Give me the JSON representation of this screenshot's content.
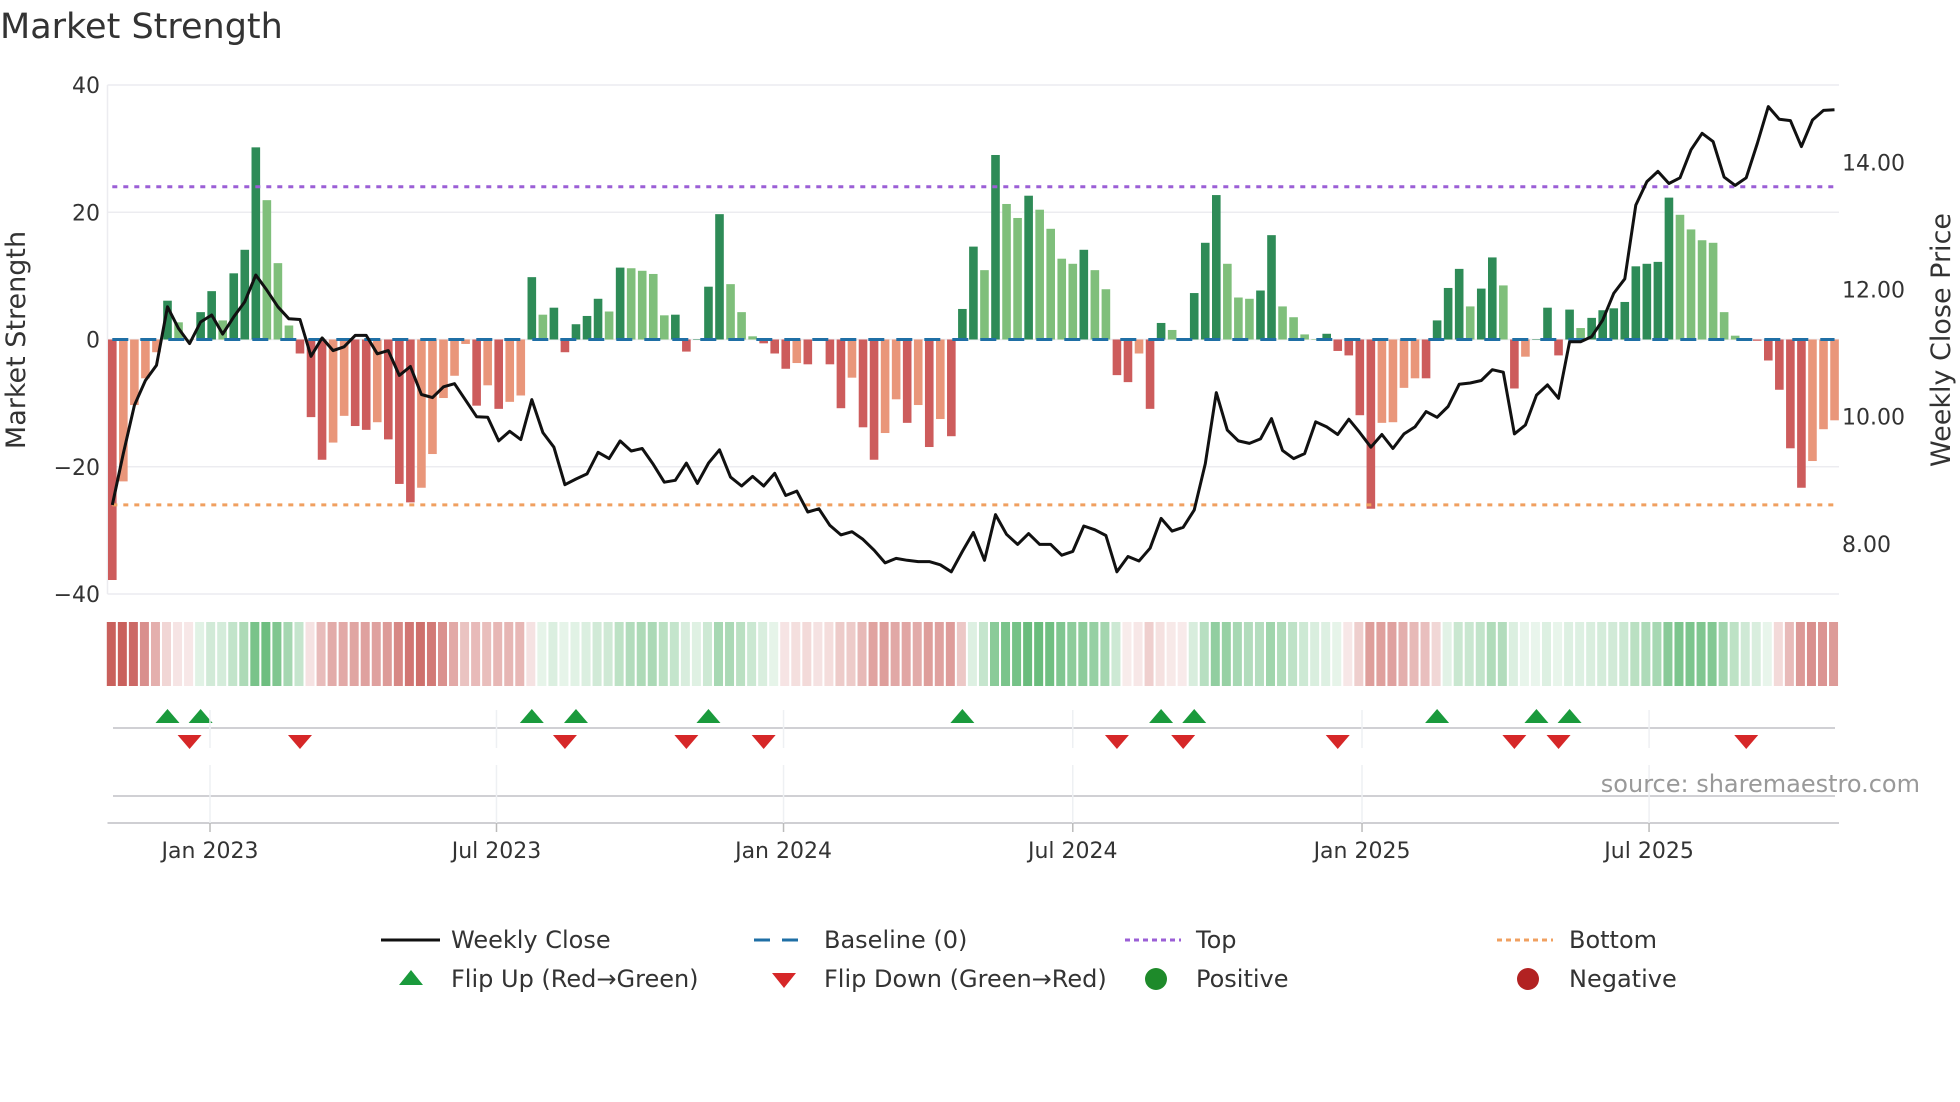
{
  "chart_data": {
    "type": "bar",
    "title": "Market Strength",
    "ylabel": "Market Strength",
    "y2label": "Weekly Close Price",
    "ylim": [
      -40,
      40
    ],
    "y2lim": [
      7.21,
      15.22
    ],
    "yticks": [
      "40",
      "20",
      "0",
      "−20",
      "−40"
    ],
    "ytick_values": [
      40,
      20,
      0,
      -20,
      -40
    ],
    "y2ticks": [
      "8.00",
      "10.00",
      "12.00",
      "14.00"
    ],
    "y2tick_values": [
      8,
      10,
      12,
      14
    ],
    "x_ticks": [
      {
        "label": "Jan 2023",
        "week": 8.85
      },
      {
        "label": "Jul 2023",
        "week": 34.8
      },
      {
        "label": "Jan 2024",
        "week": 60.8
      },
      {
        "label": "Jul 2024",
        "week": 87.0
      },
      {
        "label": "Jan 2025",
        "week": 113.2
      },
      {
        "label": "Jul 2025",
        "week": 139.2
      }
    ],
    "top_level": 24,
    "bottom_level": -26,
    "baseline": 0,
    "grid": true,
    "legend_placement": "bottom",
    "strength": [
      -37.8,
      -22.3,
      -10.3,
      -6.1,
      -2,
      6.1,
      2.7,
      0,
      4.3,
      7.6,
      3.0,
      10.4,
      14.1,
      30.2,
      21.9,
      12.0,
      2.2,
      -2.2,
      -12.2,
      -18.9,
      -16.2,
      -12,
      -13.6,
      -14.2,
      -13,
      -15.7,
      -22.7,
      -25.6,
      -23.3,
      -18,
      -9.2,
      -5.7,
      -0.7,
      -10.4,
      -7.2,
      -10.9,
      -9.8,
      -8.8,
      9.8,
      3.9,
      5,
      -2.0,
      2.4,
      3.7,
      6.4,
      4.4,
      11.3,
      11.2,
      10.8,
      10.3,
      3.8,
      3.9,
      -1.9,
      0,
      8.3,
      19.7,
      8.7,
      4.3,
      0.5,
      -0.6,
      -2.2,
      -4.6,
      -3.7,
      -3.9,
      0,
      -3.9,
      -10.8,
      -6,
      -13.8,
      -18.9,
      -14.7,
      -9.4,
      -13.1,
      -10.3,
      -16.9,
      -12.5,
      -15.2,
      4.8,
      14.6,
      10.9,
      29.0,
      21.3,
      19.1,
      22.6,
      20.4,
      17.4,
      12.7,
      11.9,
      14.1,
      10.9,
      7.9,
      -5.6,
      -6.7,
      -2.2,
      -10.9,
      2.6,
      1.5,
      0,
      7.3,
      15.2,
      22.7,
      11.9,
      6.6,
      6.4,
      7.7,
      16.4,
      5.2,
      3.5,
      0.8,
      0,
      0.9,
      -1.8,
      -2.5,
      -11.9,
      -26.6,
      -13.1,
      -13,
      -7.6,
      -6.1,
      -6.1,
      3.0,
      8.1,
      11.1,
      5.2,
      8.0,
      12.9,
      8.5,
      -7.7,
      -2.7,
      0,
      5.0,
      -2.5,
      4.7,
      1.8,
      3.4,
      4.6,
      4.9,
      5.9,
      11.5,
      11.9,
      12.2,
      22.3,
      19.6,
      17.3,
      15.6,
      15.2,
      4.3,
      0.6,
      0,
      -0.2,
      -3.3,
      -7.9,
      -17.1,
      -23.3,
      -19.1,
      -14.1,
      -12.7
    ],
    "weekly_close": [
      8.61,
      9.42,
      10.18,
      10.57,
      10.81,
      11.73,
      11.39,
      11.15,
      11.49,
      11.6,
      11.3,
      11.57,
      11.81,
      12.23,
      11.99,
      11.73,
      11.54,
      11.53,
      10.95,
      11.24,
      11.04,
      11.1,
      11.28,
      11.28,
      10.99,
      11.04,
      10.65,
      10.79,
      10.35,
      10.3,
      10.47,
      10.52,
      10.26,
      10.0,
      9.99,
      9.62,
      9.77,
      9.64,
      10.27,
      9.75,
      9.52,
      8.93,
      9.02,
      9.1,
      9.44,
      9.34,
      9.62,
      9.46,
      9.5,
      9.25,
      8.97,
      9.0,
      9.27,
      8.95,
      9.27,
      9.48,
      9.05,
      8.91,
      9.06,
      8.91,
      9.11,
      8.76,
      8.83,
      8.5,
      8.55,
      8.29,
      8.14,
      8.19,
      8.07,
      7.9,
      7.7,
      7.77,
      7.74,
      7.72,
      7.72,
      7.67,
      7.56,
      7.88,
      8.18,
      7.74,
      8.46,
      8.15,
      7.99,
      8.16,
      7.99,
      7.99,
      7.82,
      7.88,
      8.28,
      8.22,
      8.13,
      7.56,
      7.8,
      7.73,
      7.93,
      8.4,
      8.2,
      8.26,
      8.53,
      9.26,
      10.38,
      9.79,
      9.62,
      9.58,
      9.65,
      9.97,
      9.47,
      9.34,
      9.42,
      9.92,
      9.84,
      9.72,
      9.96,
      9.75,
      9.52,
      9.72,
      9.5,
      9.73,
      9.84,
      10.08,
      9.99,
      10.16,
      10.51,
      10.53,
      10.57,
      10.74,
      10.7,
      9.73,
      9.87,
      10.34,
      10.5,
      10.29,
      11.18,
      11.18,
      11.26,
      11.52,
      11.94,
      12.17,
      13.33,
      13.7,
      13.86,
      13.67,
      13.76,
      14.2,
      14.46,
      14.33,
      13.77,
      13.64,
      13.76,
      14.3,
      14.88,
      14.68,
      14.66,
      14.25,
      14.67,
      14.82,
      14.83
    ],
    "flip_up_weeks": [
      5,
      8,
      38,
      42,
      54,
      77,
      95,
      98,
      120,
      129,
      132
    ],
    "flip_down_weeks": [
      7,
      17,
      41,
      52,
      59,
      91,
      97,
      111,
      127,
      131,
      148
    ],
    "legend": [
      {
        "label": "Weekly Close",
        "kind": "line"
      },
      {
        "label": "Baseline (0)",
        "kind": "dash"
      },
      {
        "label": "Top",
        "kind": "dot-top"
      },
      {
        "label": "Bottom",
        "kind": "dot-bottom"
      },
      {
        "label": "Flip Up (Red→Green)",
        "kind": "tri-up"
      },
      {
        "label": "Flip Down (Green→Red)",
        "kind": "tri-down"
      },
      {
        "label": "Positive",
        "kind": "circle-pos"
      },
      {
        "label": "Negative",
        "kind": "circle-neg"
      }
    ],
    "source": "source: sharemaestro.com",
    "colors": {
      "pos_rising": "#2e8b57",
      "pos_falling": "#7fbf7b",
      "neg_falling": "#cd5c5c",
      "neg_rising": "#e9967a",
      "line": "#111111",
      "baseline": "#1f6fa5",
      "top": "#9b5fd6",
      "bottom": "#f0a060",
      "flip_up": "#1a9a3c",
      "flip_down": "#d62728",
      "positive": "#1e8a2a",
      "negative": "#b22222",
      "strip_pos": "#4caf63",
      "strip_neg": "#c9605c"
    }
  }
}
